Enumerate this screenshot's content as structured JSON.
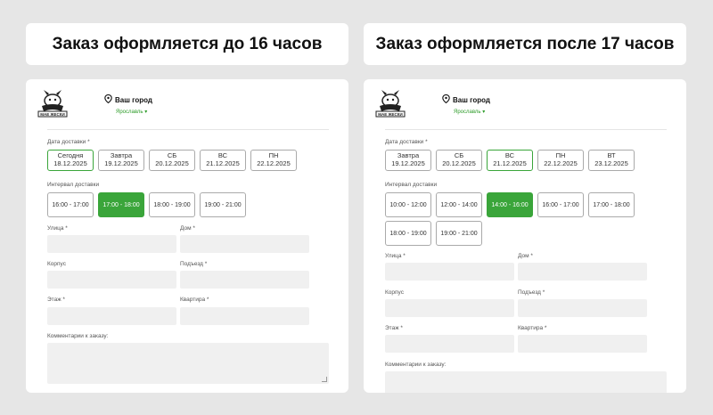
{
  "headers": {
    "left": "Заказ оформляется до 16 часов",
    "right": "Заказ оформляется после 17 часов"
  },
  "brand": {
    "logo_text": "МАЕ ЖЕСКИ"
  },
  "city": {
    "label": "Ваш город",
    "value": "Ярославль ▾"
  },
  "form_labels": {
    "delivery_date": "Дата доставки *",
    "delivery_interval": "Интервал доставки",
    "street": "Улица *",
    "house": "Дом *",
    "building": "Корпус",
    "entrance": "Подъезд *",
    "floor": "Этаж *",
    "apartment": "Квартира *",
    "comment": "Комментарии к заказу:"
  },
  "left": {
    "dates": [
      {
        "day": "Сегодня",
        "date": "18.12.2025",
        "active": true
      },
      {
        "day": "Завтра",
        "date": "19.12.2025",
        "active": false
      },
      {
        "day": "СБ",
        "date": "20.12.2025",
        "active": false
      },
      {
        "day": "ВС",
        "date": "21.12.2025",
        "active": false
      },
      {
        "day": "ПН",
        "date": "22.12.2025",
        "active": false
      }
    ],
    "intervals": [
      {
        "label": "16:00 - 17:00",
        "active": false
      },
      {
        "label": "17:00 - 18:00",
        "active": true
      },
      {
        "label": "18:00 - 19:00",
        "active": false
      },
      {
        "label": "19:00 - 21:00",
        "active": false
      }
    ]
  },
  "right": {
    "dates": [
      {
        "day": "Завтра",
        "date": "19.12.2025",
        "active": false
      },
      {
        "day": "СБ",
        "date": "20.12.2025",
        "active": false
      },
      {
        "day": "ВС",
        "date": "21.12.2025",
        "active": true
      },
      {
        "day": "ПН",
        "date": "22.12.2025",
        "active": false
      },
      {
        "day": "ВТ",
        "date": "23.12.2025",
        "active": false
      }
    ],
    "intervals": [
      {
        "label": "10:00 - 12:00",
        "active": false
      },
      {
        "label": "12:00 - 14:00",
        "active": false
      },
      {
        "label": "14:00 - 16:00",
        "active": true
      },
      {
        "label": "16:00 - 17:00",
        "active": false
      },
      {
        "label": "17:00 - 18:00",
        "active": false
      },
      {
        "label": "18:00 - 19:00",
        "active": false
      },
      {
        "label": "19:00 - 21:00",
        "active": false
      }
    ]
  },
  "colors": {
    "accent_green": "#3aa53a",
    "city_green": "#2e9c2a",
    "field_bg": "#f0f0f0",
    "page_bg": "#e6e6e6"
  }
}
